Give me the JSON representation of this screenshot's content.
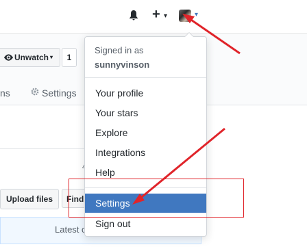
{
  "header": {
    "notifications_icon": "bell-icon",
    "new_icon": "plus-icon",
    "new_caret": "▾",
    "avatar_caret": "▾"
  },
  "repo": {
    "watch_button": {
      "icon": "eye-icon",
      "label": "Unwatch",
      "caret": "▾",
      "count": "1"
    },
    "tabs": {
      "partial_label": "ns",
      "settings_label": "Settings",
      "settings_icon": "gear-icon"
    },
    "file_actions": {
      "upload": "Upload files",
      "find": "Find"
    },
    "latest_commit": "Latest c",
    "edge_char": "4"
  },
  "user_menu": {
    "signed_in_as": "Signed in as",
    "username": "sunnyvinson",
    "items": [
      {
        "label": "Your profile"
      },
      {
        "label": "Your stars"
      },
      {
        "label": "Explore"
      },
      {
        "label": "Integrations"
      },
      {
        "label": "Help"
      },
      {
        "label": "Settings",
        "highlighted": true
      },
      {
        "label": "Sign out"
      }
    ]
  },
  "colors": {
    "highlight": "#4078c0",
    "annotation_red": "#e0242a",
    "avatar_caret": "#4078c0"
  }
}
